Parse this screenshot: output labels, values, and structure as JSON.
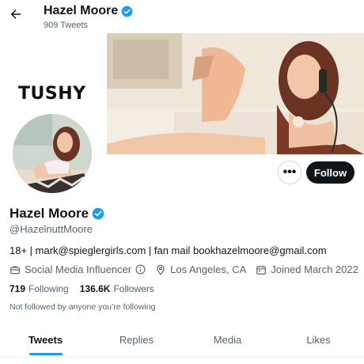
{
  "header": {
    "name": "Hazel Moore",
    "tweet_count": "909 Tweets"
  },
  "banner": {
    "brand_logo_text": "TUSHY"
  },
  "profile": {
    "display_name": "Hazel Moore",
    "handle": "@HazelnuttMoore",
    "bio": "18+ | mark@spieglergirls.com | fan mail bookhazelmoore@gmail.com",
    "category": "Social Media Influencer",
    "location": "Los Angeles, CA",
    "joined": "Joined March 2022",
    "following_count": "719",
    "following_label": "Following",
    "followers_count": "136.6K",
    "followers_label": "Followers",
    "not_followed_note": "Not followed by anyone you’re following",
    "verified": true
  },
  "actions": {
    "more_label": "•••",
    "follow_label": "Follow"
  },
  "tabs": [
    {
      "label": "Tweets",
      "active": true
    },
    {
      "label": "Replies",
      "active": false
    },
    {
      "label": "Media",
      "active": false
    },
    {
      "label": "Likes",
      "active": false
    }
  ],
  "colors": {
    "accent": "#1d9bf0",
    "text_primary": "#0f1419",
    "text_secondary": "#536471",
    "follow_button_bg": "#0f1419"
  },
  "icons": {
    "back": "arrow-left-icon",
    "verified": "verified-badge-icon",
    "category": "briefcase-icon",
    "info": "info-icon",
    "location": "location-pin-icon",
    "calendar": "calendar-icon"
  }
}
